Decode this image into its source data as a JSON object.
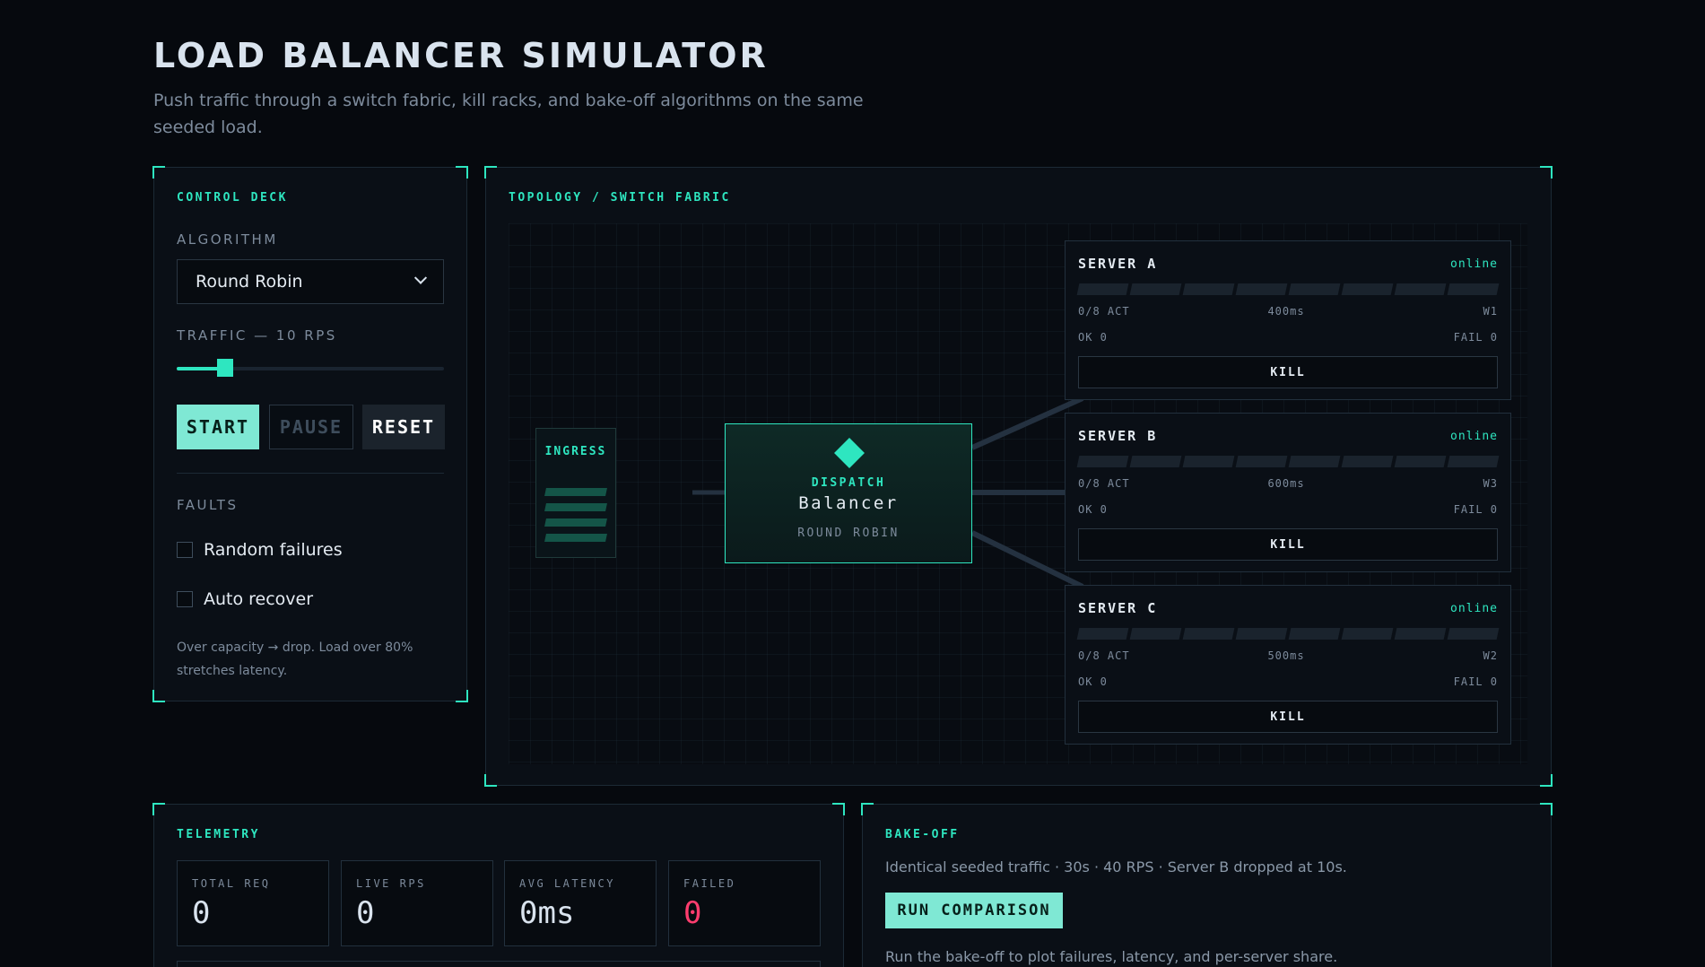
{
  "header": {
    "title": "LOAD BALANCER SIMULATOR",
    "subtitle": "Push traffic through a switch fabric, kill racks, and bake-off algorithms on the same seeded load."
  },
  "control_deck": {
    "label": "CONTROL DECK",
    "algorithm_label": "ALGORITHM",
    "algorithm_value": "Round Robin",
    "traffic_label": "TRAFFIC — 10 RPS",
    "traffic_rps": 10,
    "traffic_fraction": 0.18,
    "start_label": "START",
    "pause_label": "PAUSE",
    "reset_label": "RESET",
    "faults_label": "FAULTS",
    "random_failures_label": "Random failures",
    "random_failures_checked": false,
    "auto_recover_label": "Auto recover",
    "auto_recover_checked": false,
    "note": "Over capacity → drop. Load over 80% stretches latency."
  },
  "topology": {
    "label": "TOPOLOGY / SWITCH FABRIC",
    "ingress_label": "INGRESS",
    "balancer": {
      "kicker": "DISPATCH",
      "title": "Balancer",
      "algorithm": "ROUND ROBIN"
    },
    "servers": [
      {
        "name": "SERVER A",
        "status": "online",
        "active": "0/8 ACT",
        "latency": "400ms",
        "weight": "W1",
        "ok": "OK 0",
        "fail": "FAIL 0",
        "kill_label": "KILL"
      },
      {
        "name": "SERVER B",
        "status": "online",
        "active": "0/8 ACT",
        "latency": "600ms",
        "weight": "W3",
        "ok": "OK 0",
        "fail": "FAIL 0",
        "kill_label": "KILL"
      },
      {
        "name": "SERVER C",
        "status": "online",
        "active": "0/8 ACT",
        "latency": "500ms",
        "weight": "W2",
        "ok": "OK 0",
        "fail": "FAIL 0",
        "kill_label": "KILL"
      }
    ]
  },
  "telemetry": {
    "label": "TELEMETRY",
    "metrics": [
      {
        "label": "TOTAL REQ",
        "value": "0"
      },
      {
        "label": "LIVE RPS",
        "value": "0"
      },
      {
        "label": "AVG LATENCY",
        "value": "0ms"
      },
      {
        "label": "FAILED",
        "value": "0"
      }
    ]
  },
  "bakeoff": {
    "label": "BAKE-OFF",
    "description": "Identical seeded traffic · 30s · 40 RPS · Server B dropped at 10s.",
    "button_label": "RUN COMPARISON",
    "hint": "Run the bake-off to plot failures, latency, and per-server share."
  },
  "colors": {
    "accent": "#2ee6c0",
    "danger": "#ff3d6e",
    "background": "#06090e"
  }
}
